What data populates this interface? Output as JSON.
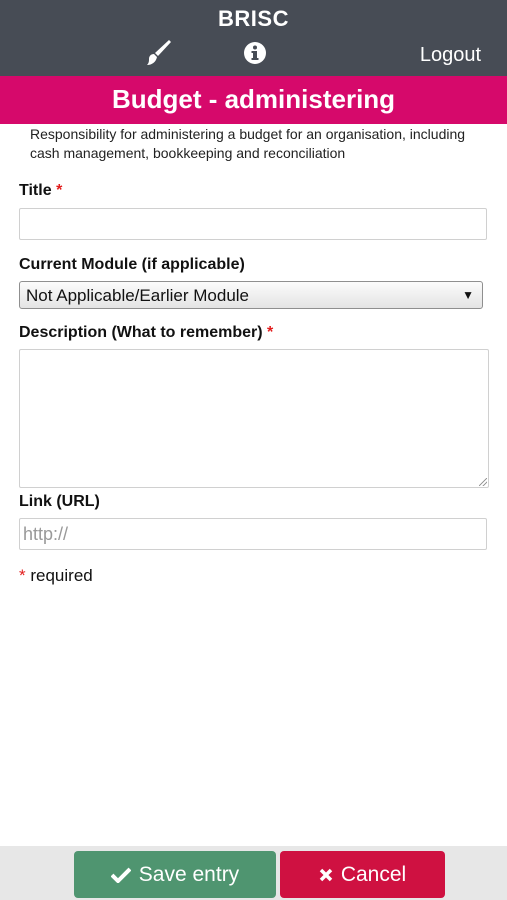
{
  "header": {
    "app_title": "BRISC",
    "logout_label": "Logout",
    "icons": [
      "paintbrush-icon",
      "info-icon"
    ]
  },
  "page": {
    "title": "Budget - administering",
    "description": "Responsibility for administering a budget for an organisation, including cash management, bookkeeping and reconciliation"
  },
  "form": {
    "title_label": "Title",
    "required_marker": "*",
    "title_value": "",
    "module_label": "Current Module (if applicable)",
    "module_selected": "Not Applicable/Earlier Module",
    "description_label": "Description (What to remember)",
    "description_value": "",
    "link_label": "Link (URL)",
    "link_placeholder": "http://",
    "required_note": "required"
  },
  "footer": {
    "save_label": "Save entry",
    "cancel_label": "Cancel"
  },
  "colors": {
    "header_bg": "#474c55",
    "page_bar": "#d6096b",
    "save": "#4f9570",
    "cancel": "#cf1141",
    "required": "#e21c1c"
  }
}
